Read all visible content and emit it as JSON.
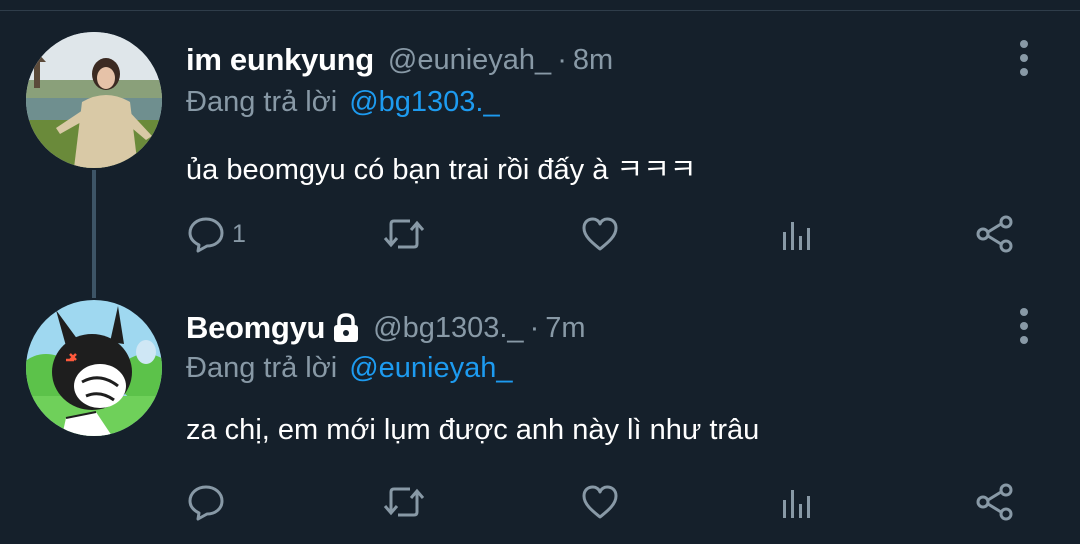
{
  "tweets": [
    {
      "name": "im eunkyung",
      "verified_lock": false,
      "handle": "@eunieyah_",
      "dot": "·",
      "time": "8m",
      "reply_label": "Đang trả lời",
      "reply_to": "@bg1303._",
      "text": "ủa beomgyu có bạn trai rồi đấy à ㅋㅋㅋ",
      "reply_count": "1",
      "avatar_icon": "photo-avatar"
    },
    {
      "name": "Beomgyu",
      "verified_lock": true,
      "handle": "@bg1303._",
      "dot": "·",
      "time": "7m",
      "reply_label": "Đang trả lời",
      "reply_to": "@eunieyah_",
      "text": "za chị, em mới lụm được anh này lì như trâu",
      "reply_count": "",
      "avatar_icon": "cartoon-avatar"
    }
  ],
  "colors": {
    "background": "#15202b",
    "secondary_text": "#8899a6",
    "link": "#1d9bf0",
    "thread_line": "#3d5466"
  },
  "action_icons": [
    "reply-icon",
    "retweet-icon",
    "like-icon",
    "analytics-icon",
    "share-icon"
  ]
}
